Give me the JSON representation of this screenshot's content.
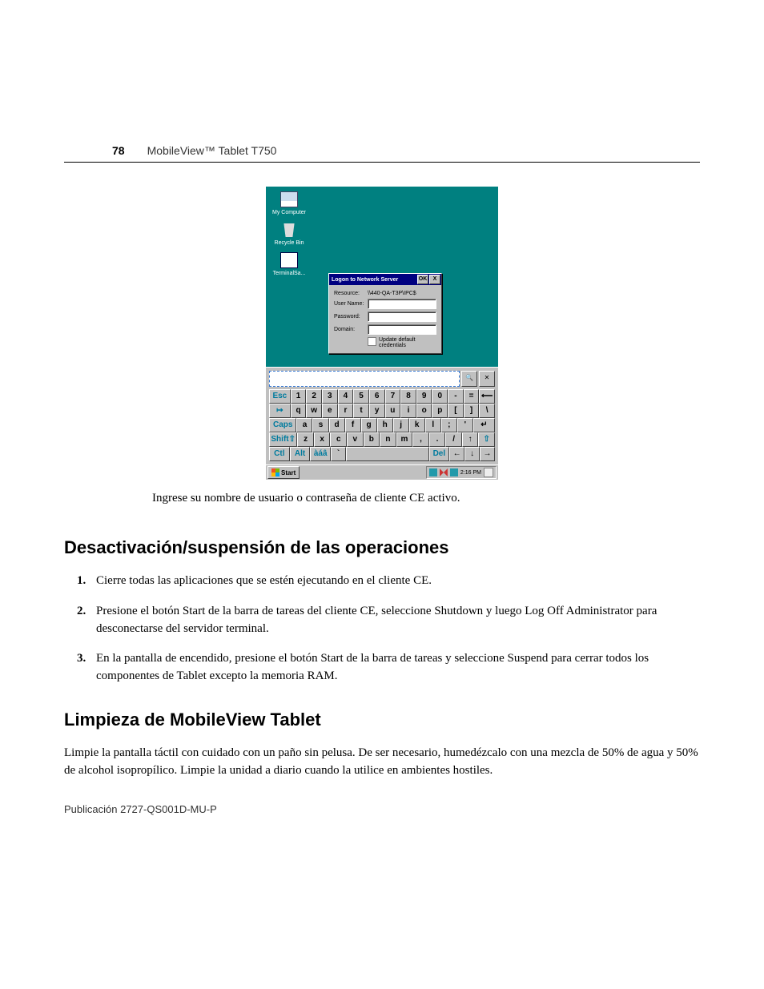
{
  "page": {
    "number": "78",
    "header": "MobileView™ Tablet T750",
    "publication": "Publicación  2727-QS001D-MU-P"
  },
  "screenshot": {
    "desktop_icons": {
      "my_computer": "My Computer",
      "recycle_bin": "Recycle Bin",
      "terminal": "TerminalSa..."
    },
    "dialog": {
      "title": "Logon to Network Server",
      "ok": "OK",
      "close": "X",
      "resource_label": "Resource:",
      "resource_value": "\\\\440-QA-T3P\\IPC$",
      "username_label": "User Name:",
      "password_label": "Password:",
      "domain_label": "Domain:",
      "update_creds": "Update default credentials"
    },
    "input_panel": {
      "magnify_label": "🔍",
      "close_label": "✕"
    },
    "keyboard": {
      "row1": [
        "Esc",
        "1",
        "2",
        "3",
        "4",
        "5",
        "6",
        "7",
        "8",
        "9",
        "0",
        "-",
        "=",
        "⟵"
      ],
      "row2": [
        "↦",
        "q",
        "w",
        "e",
        "r",
        "t",
        "y",
        "u",
        "i",
        "o",
        "p",
        "[",
        "]",
        "\\"
      ],
      "row3": [
        "Caps",
        "a",
        "s",
        "d",
        "f",
        "g",
        "h",
        "j",
        "k",
        "l",
        ";",
        "'",
        "↵"
      ],
      "row4": [
        "Shift⇧",
        "z",
        "x",
        "c",
        "v",
        "b",
        "n",
        "m",
        ",",
        ".",
        "/",
        "↑",
        "⇧"
      ],
      "row5": [
        "Ctl",
        "Alt",
        "àáâ",
        "`",
        " ",
        "Del",
        "←",
        "↓",
        "→"
      ]
    },
    "taskbar": {
      "start": "Start",
      "time": "2:16 PM"
    }
  },
  "caption": "Ingrese su nombre de usuario o contraseña de cliente CE activo.",
  "section1": {
    "title": "Desactivación/suspensión de las operaciones",
    "steps": [
      "Cierre todas las aplicaciones que se estén ejecutando en el cliente CE.",
      "Presione el botón Start de la barra de tareas del cliente CE, seleccione Shutdown y luego Log Off Administrator para desconectarse del servidor terminal.",
      "En la pantalla de encendido, presione el botón Start de la barra de tareas y seleccione Suspend para cerrar todos los componentes de Tablet excepto la memoria RAM."
    ]
  },
  "section2": {
    "title": "Limpieza de MobileView Tablet",
    "body": "Limpie la pantalla táctil con cuidado con un paño sin pelusa. De ser necesario, humedézcalo con una mezcla de 50% de agua y 50% de alcohol isopropílico. Limpie la unidad a diario cuando la utilice en ambientes hostiles."
  }
}
